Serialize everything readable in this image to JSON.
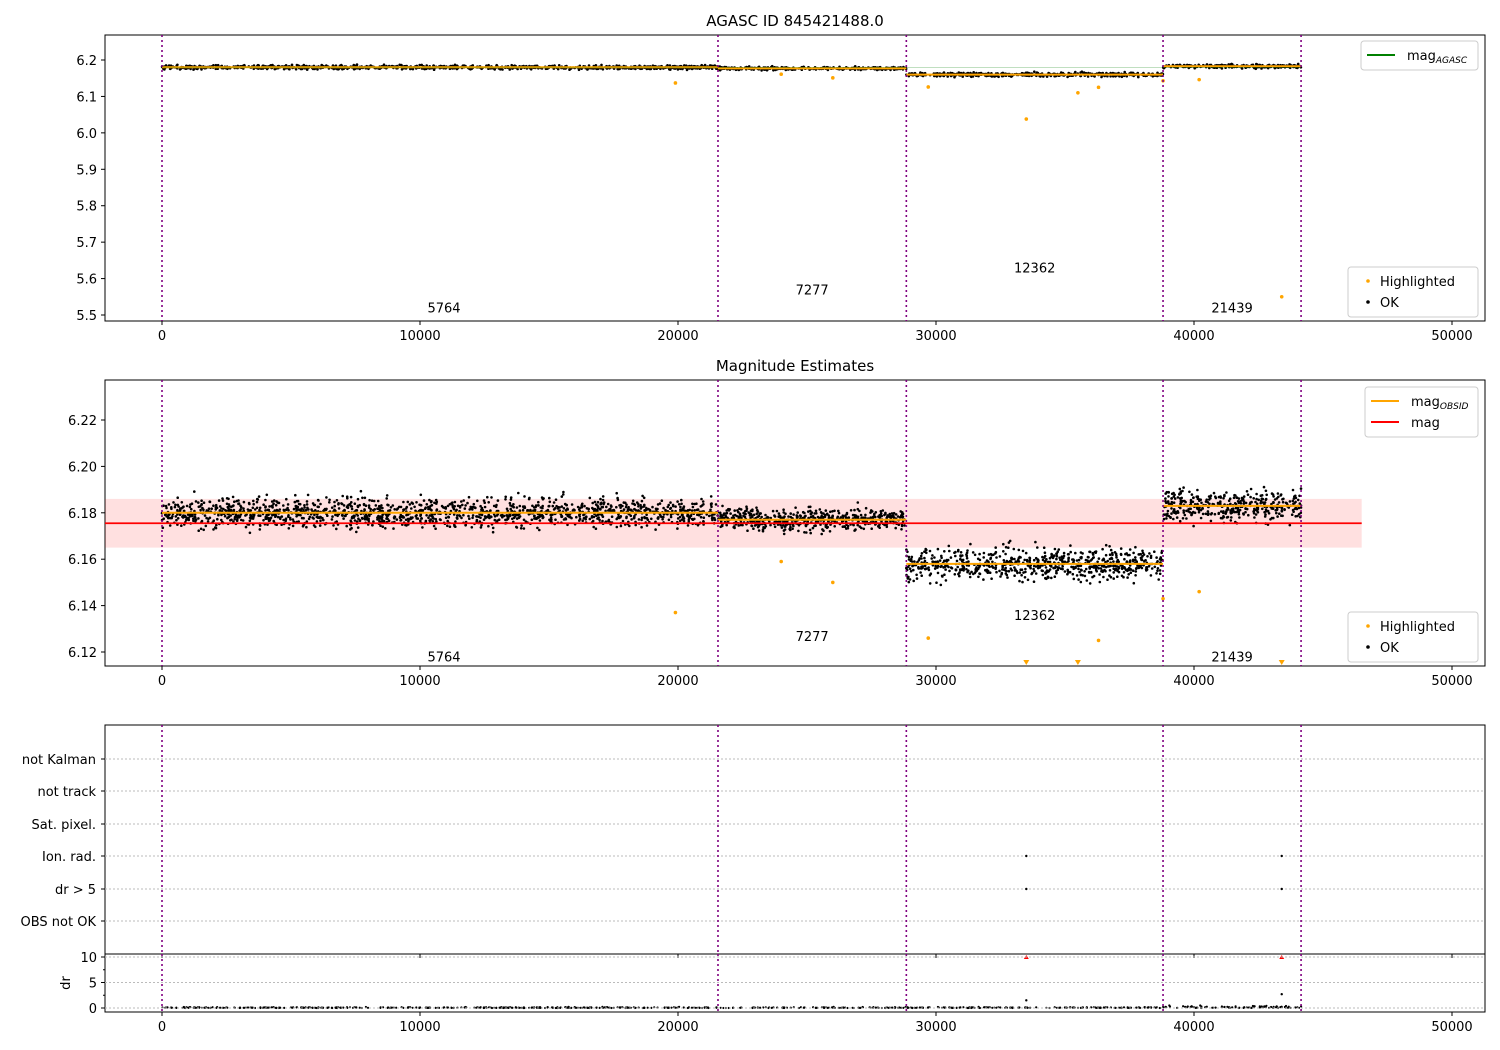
{
  "chart_data": [
    {
      "type": "scatter",
      "title": "AGASC ID 845421488.0",
      "xlim": [
        -2200,
        51300
      ],
      "ylim": [
        5.485,
        6.268
      ],
      "xticks": [
        0,
        10000,
        20000,
        30000,
        40000,
        50000
      ],
      "yticks": [
        5.5,
        5.6,
        5.7,
        5.8,
        5.9,
        6.0,
        6.1,
        6.2
      ],
      "ytick_decimals": 1,
      "legend_top": [
        {
          "label": "mag",
          "sub": "AGASC",
          "color": "#008000",
          "kind": "line"
        }
      ],
      "legend_bottom": [
        {
          "label": "Highlighted",
          "color": "#ffa500"
        },
        {
          "label": "OK",
          "color": "#000000"
        }
      ],
      "mag_agasc": 6.18,
      "segments": [
        {
          "obsid": "5764",
          "x0": 0,
          "x1": 21550,
          "mean": 6.18,
          "spread": 0.004,
          "label_y": 5.52
        },
        {
          "obsid": "7277",
          "x0": 21550,
          "x1": 28850,
          "mean": 6.177,
          "spread": 0.003,
          "label_y": 5.57
        },
        {
          "obsid": "12362",
          "x0": 28850,
          "x1": 38800,
          "mean": 6.16,
          "spread": 0.004,
          "label_y": 5.63
        },
        {
          "obsid": "21439",
          "x0": 38800,
          "x1": 44150,
          "mean": 6.183,
          "spread": 0.004,
          "label_y": 5.52
        }
      ],
      "outliers": [
        [
          19900,
          6.137
        ],
        [
          24000,
          6.161
        ],
        [
          26000,
          6.151
        ],
        [
          29700,
          6.126
        ],
        [
          33500,
          6.038
        ],
        [
          35500,
          6.11
        ],
        [
          36300,
          6.125
        ],
        [
          38800,
          6.143
        ],
        [
          40200,
          6.146
        ],
        [
          43400,
          5.55
        ]
      ]
    },
    {
      "type": "scatter",
      "title": "Magnitude Estimates",
      "xlim": [
        -2200,
        51300
      ],
      "ylim": [
        6.114,
        6.238
      ],
      "xticks": [
        0,
        10000,
        20000,
        30000,
        40000,
        50000
      ],
      "yticks": [
        6.12,
        6.14,
        6.16,
        6.18,
        6.2,
        6.22
      ],
      "ytick_decimals": 2,
      "legend_top": [
        {
          "label": "mag",
          "sub": "OBSID",
          "color": "#ffa500",
          "kind": "line"
        },
        {
          "label": "mag",
          "sub": "",
          "color": "#ff0000",
          "kind": "line"
        }
      ],
      "legend_bottom": [
        {
          "label": "Highlighted",
          "color": "#ffa500"
        },
        {
          "label": "OK",
          "color": "#000000"
        }
      ],
      "mag": 6.1755,
      "mag_band": [
        6.165,
        6.186
      ],
      "mag_band_xmax": 46500,
      "segments": [
        {
          "obsid": "5764",
          "x0": 0,
          "x1": 21550,
          "mean": 6.18,
          "spread": 0.0045,
          "label_y": 6.118
        },
        {
          "obsid": "7277",
          "x0": 21550,
          "x1": 28850,
          "mean": 6.177,
          "spread": 0.0035,
          "label_y": 6.127
        },
        {
          "obsid": "12362",
          "x0": 28850,
          "x1": 38800,
          "mean": 6.158,
          "spread": 0.005,
          "label_y": 6.136
        },
        {
          "obsid": "21439",
          "x0": 38800,
          "x1": 44150,
          "mean": 6.183,
          "spread": 0.005,
          "label_y": 6.118
        }
      ],
      "outliers": [
        [
          19900,
          6.137
        ],
        [
          24000,
          6.159
        ],
        [
          26000,
          6.15
        ],
        [
          29700,
          6.126
        ],
        [
          36300,
          6.125
        ],
        [
          38800,
          6.143
        ],
        [
          40200,
          6.146
        ]
      ],
      "below_range_x": [
        33500,
        35500,
        43400
      ]
    },
    {
      "type": "scatter",
      "xlim": [
        -2200,
        51300
      ],
      "categories": [
        "OBS not OK",
        "dr > 5",
        "Ion. rad.",
        "Sat. pixel.",
        "not track",
        "not Kalman"
      ],
      "flags": [
        {
          "category": "Ion. rad.",
          "x": [
            33500,
            43400
          ]
        },
        {
          "category": "dr > 5",
          "x": [
            33500,
            43400
          ]
        }
      ]
    },
    {
      "type": "scatter",
      "ylabel": "dr",
      "xlim": [
        -2200,
        51300
      ],
      "ylim": [
        -0.4,
        10.6
      ],
      "yticks": [
        0,
        5,
        10
      ],
      "xticks": [
        0,
        10000,
        20000,
        30000,
        40000,
        50000
      ],
      "clipped_x": [
        33500,
        43400
      ],
      "points": [
        [
          33500,
          1.5
        ],
        [
          43400,
          2.7
        ]
      ],
      "typical_dr": 0.2
    }
  ],
  "obsid_boundaries": [
    0,
    21550,
    28850,
    38800,
    44150
  ]
}
